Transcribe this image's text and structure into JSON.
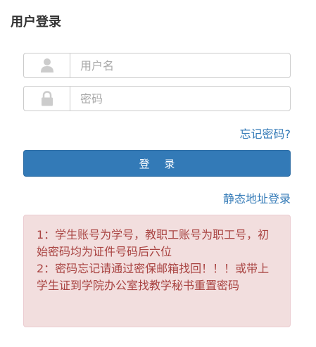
{
  "header": {
    "title": "用户登录"
  },
  "form": {
    "username": {
      "icon": "user-icon",
      "placeholder": "用户名",
      "value": ""
    },
    "password": {
      "icon": "lock-icon",
      "placeholder": "密码",
      "value": ""
    },
    "forgot_link": "忘记密码?",
    "login_button": "登 录",
    "static_login_link": "静态地址登录"
  },
  "notice": {
    "line1": "1：学生账号为学号，教职工账号为职工号，初始密码均为证件号码后六位",
    "line2": "2：密码忘记请通过密保邮箱找回！！！或带上学生证到学院办公室找教学秘书重置密码"
  },
  "colors": {
    "primary": "#337ab7",
    "notice_bg": "#f2dede",
    "notice_text": "#a94442",
    "icon": "#cccccc"
  }
}
